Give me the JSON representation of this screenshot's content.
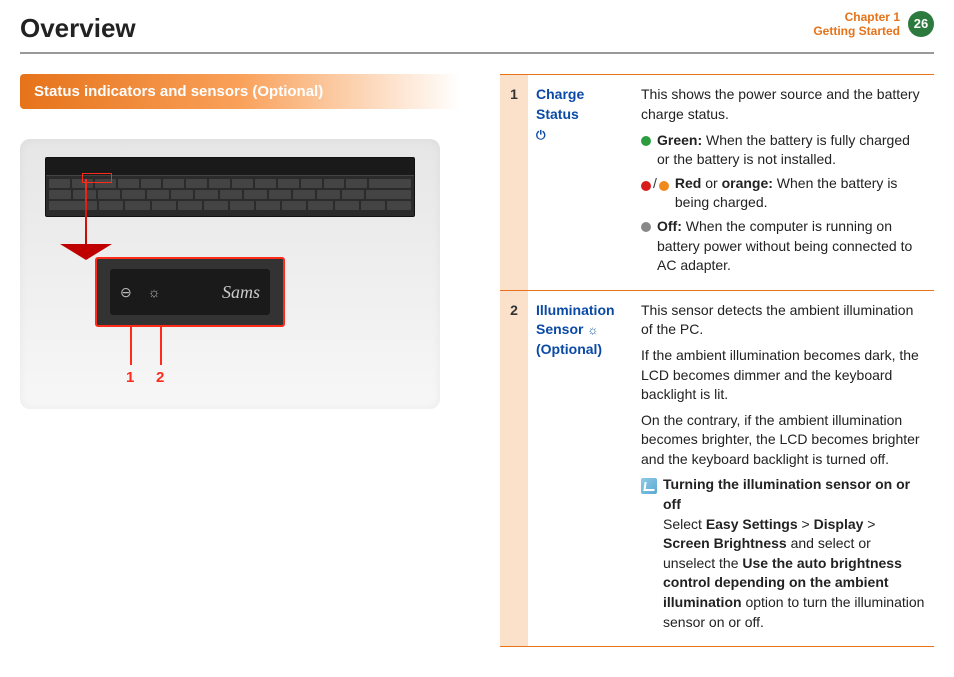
{
  "header": {
    "title": "Overview",
    "chapter_line1": "Chapter 1",
    "chapter_line2": "Getting Started",
    "page_number": "26"
  },
  "section_heading": "Status indicators and sensors (Optional)",
  "diagram": {
    "callout_1": "1",
    "callout_2": "2",
    "brand_text": "Sams"
  },
  "table": {
    "rows": [
      {
        "num": "1",
        "label": "Charge Status",
        "icon": "⏻",
        "desc_intro": "This shows the power source and the battery charge status.",
        "items": [
          {
            "dot_color": "green",
            "label": "Green:",
            "text": " When the battery is fully charged or the battery is not installed."
          },
          {
            "dot_color": "red_orange",
            "label": "Red",
            "mid": " or ",
            "label2": "orange:",
            "text": " When the battery is being charged."
          },
          {
            "dot_color": "grey",
            "label": "Off:",
            "text": " When the computer is running on battery power without being connected to AC adapter."
          }
        ]
      },
      {
        "num": "2",
        "label_line1": "Illumination",
        "label_line2": "Sensor",
        "label_line3": "(Optional)",
        "icon": "☼",
        "p1": "This sensor detects the ambient illumination of the PC.",
        "p2": "If the ambient illumination becomes dark, the LCD becomes dimmer and the keyboard backlight is lit.",
        "p3": "On the contrary, if the ambient illumination becomes brighter, the LCD becomes brighter and the keyboard backlight is turned off.",
        "note_title": "Turning the illumination sensor on or off",
        "note_pre": "Select ",
        "note_path1": "Easy Settings",
        "note_gt1": " > ",
        "note_path2": "Display",
        "note_gt2": " > ",
        "note_path3": "Screen Brightness",
        "note_mid": " and select or unselect the ",
        "note_opt": "Use the auto brightness control depending on the ambient illumination",
        "note_post": " option to turn the illumination sensor on or off."
      }
    ]
  }
}
